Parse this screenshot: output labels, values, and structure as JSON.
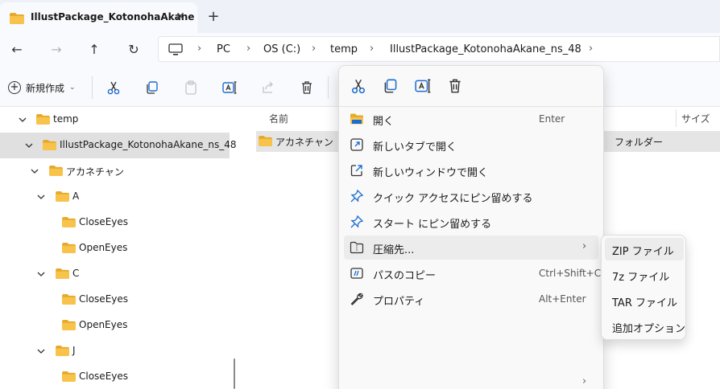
{
  "window": {
    "tab_title": "IllustPackage_KotonohaAkane",
    "tab_close_glyph": "✕",
    "new_tab_glyph": "+"
  },
  "nav": {
    "back_glyph": "←",
    "forward_glyph": "→",
    "up_glyph": "↑",
    "refresh_glyph": "↻"
  },
  "breadcrumbs": [
    {
      "label": "PC"
    },
    {
      "label": "OS (C:)"
    },
    {
      "label": "temp"
    },
    {
      "label": "IllustPackage_KotonohaAkane_ns_48"
    }
  ],
  "breadcrumb_sep": "›",
  "toolbar": {
    "new_label": "新規作成",
    "new_caret": "⌄",
    "icons": [
      "cut-icon",
      "copy-icon",
      "paste-icon",
      "rename-icon",
      "share-icon",
      "delete-icon"
    ]
  },
  "tree": {
    "items": [
      {
        "label": "temp",
        "expanded": true
      },
      {
        "label": "IllustPackage_KotonohaAkane_ns_48",
        "expanded": true,
        "selected": true
      },
      {
        "label": "アカネチャン",
        "expanded": true
      },
      {
        "label": "A",
        "expanded": true
      },
      {
        "label": "CloseEyes"
      },
      {
        "label": "OpenEyes"
      },
      {
        "label": "C",
        "expanded": true
      },
      {
        "label": "CloseEyes"
      },
      {
        "label": "OpenEyes"
      },
      {
        "label": "J",
        "expanded": true
      },
      {
        "label": "CloseEyes"
      }
    ]
  },
  "filelist": {
    "headers": {
      "name": "名前",
      "size": "サイズ"
    },
    "rows": [
      {
        "name": "アカネチャン",
        "type": "フォルダー"
      }
    ]
  },
  "context_menu": {
    "quick_actions": [
      "cut-icon",
      "copy-icon",
      "rename-icon",
      "delete-icon"
    ],
    "items": [
      {
        "label": "開く",
        "shortcut": "Enter",
        "icon": "folder-open-icon"
      },
      {
        "label": "新しいタブで開く",
        "shortcut": "",
        "icon": "new-tab-icon"
      },
      {
        "label": "新しいウィンドウで開く",
        "shortcut": "",
        "icon": "new-window-icon"
      },
      {
        "label": "クイック アクセスにピン留めする",
        "shortcut": "",
        "icon": "pin-icon"
      },
      {
        "label": "スタート にピン留めする",
        "shortcut": "",
        "icon": "pin-icon"
      },
      {
        "label": "圧縮先...",
        "shortcut": "",
        "icon": "compress-icon",
        "has_submenu": true,
        "highlighted": true
      },
      {
        "label": "パスのコピー",
        "shortcut": "Ctrl+Shift+C",
        "icon": "copy-path-icon"
      },
      {
        "label": "プロパティ",
        "shortcut": "Alt+Enter",
        "icon": "wrench-icon"
      }
    ],
    "submenu_arrow": "›",
    "more_arrow": "›"
  },
  "compress_submenu": {
    "items": [
      {
        "label": "ZIP ファイル",
        "highlighted": true
      },
      {
        "label": "7z ファイル"
      },
      {
        "label": "TAR ファイル"
      },
      {
        "label": "追加オプション"
      }
    ]
  },
  "colors": {
    "folder": "#f8c34a",
    "folder_dark": "#e7a92b",
    "accent_blue": "#1c6dd0",
    "selected_row": "#e0e0e0",
    "menu_bg": "#f9f9f9"
  }
}
